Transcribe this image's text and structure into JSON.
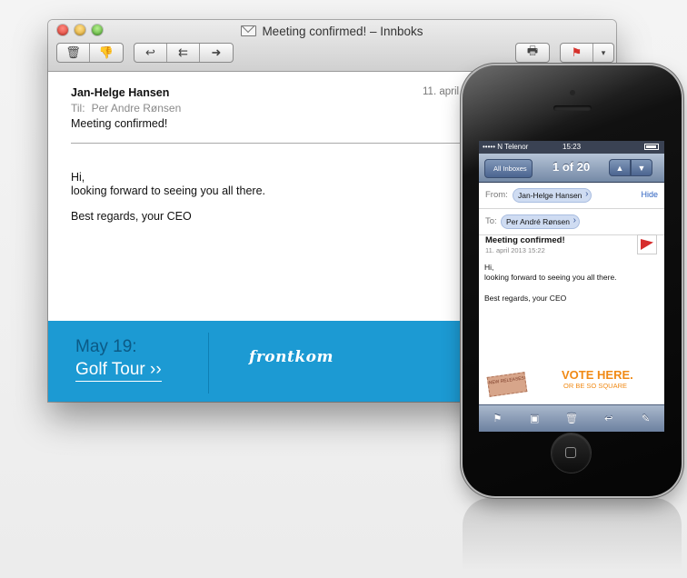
{
  "window": {
    "title": "Meeting confirmed! – Innboks",
    "toolbar": {
      "delete": "🗑",
      "junk": "👎",
      "reply": "↩",
      "reply_all": "⇇",
      "forward": "➜",
      "print": "🖶",
      "flag": "⚑",
      "flag_menu": "▾"
    }
  },
  "message": {
    "from": "Jan-Helge Hansen",
    "date": "11. april",
    "to_label": "Til:",
    "to": "Per Andre Rønsen",
    "subject": "Meeting confirmed!",
    "greeting": "Hi,",
    "line1": "looking forward to seeing you all there.",
    "sign": "Best regards, your CEO"
  },
  "banner": {
    "date": "May 19:",
    "link": "Golf Tour ››",
    "logo": "frontkom",
    "color": "#1c9ad3"
  },
  "phone": {
    "status": {
      "carrier": "••••• N Telenor",
      "time": "15:23"
    },
    "nav": {
      "back": "All Inboxes",
      "counter": "1 of 20",
      "up": "▲",
      "down": "▼"
    },
    "from_label": "From:",
    "from": "Jan-Helge Hansen",
    "hide": "Hide",
    "to_label": "To:",
    "to": "Per André Rønsen",
    "subject": "Meeting confirmed!",
    "date": "11. april 2013 15:22",
    "greeting": "Hi,",
    "line1": "looking forward to seeing you all there.",
    "sign": "Best regards, your CEO",
    "ticket": "NEW RELEASES",
    "vote": "VOTE HERE.",
    "vote_sub": "OR BE SO SQUARE",
    "toolbar": {
      "flag": "⚑",
      "folder": "▣",
      "trash": "🗑",
      "reply": "↩",
      "compose": "✎"
    }
  }
}
